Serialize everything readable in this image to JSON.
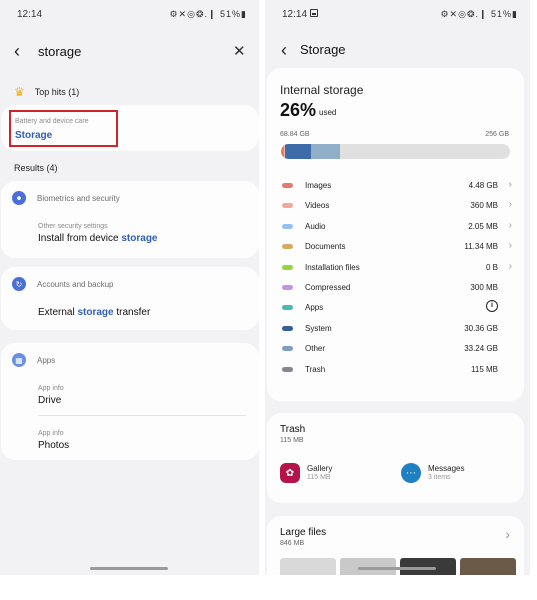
{
  "left": {
    "status": {
      "time": "12:14",
      "icons": "⚙✕◎❂.❙ 51%▮"
    },
    "search": {
      "query": "storage"
    },
    "top_hits": {
      "label": "Top hits (1)",
      "category": "Battery and device care",
      "title": "Storage"
    },
    "results": {
      "label": "Results (4)"
    },
    "sections": [
      {
        "name": "Biometrics and security",
        "sub": "Other security settings",
        "title_before": "Install from device ",
        "title_hl": "storage",
        "title_after": ""
      },
      {
        "name": "Accounts and backup",
        "title_before": "External ",
        "title_hl": "storage",
        "title_after": " transfer"
      },
      {
        "name": "Apps",
        "items": [
          {
            "sub": "App info",
            "title": "Drive"
          },
          {
            "sub": "App info",
            "title": "Photos"
          }
        ]
      }
    ]
  },
  "right": {
    "status": {
      "time": "12:14",
      "icons": "⚙✕◎❂.❙ 51%▮"
    },
    "page_title": "Storage",
    "internal": {
      "heading": "Internal storage",
      "percent": "26%",
      "used_label": "used",
      "used_amount": "68.84 GB",
      "capacity": "256 GB",
      "bar_fractions": [
        0.012,
        0.006,
        0.001,
        0.11,
        0.13
      ],
      "bar_colors": [
        "#e27a6b",
        "#f4b8ad",
        "#a9d4f3",
        "#3d6ca8",
        "#91aec8"
      ],
      "categories": [
        {
          "name": "Images",
          "size": "4.48 GB",
          "color": "#e8786a",
          "chevron": "›"
        },
        {
          "name": "Videos",
          "size": "360 MB",
          "color": "#f0a79e",
          "chevron": "›"
        },
        {
          "name": "Audio",
          "size": "2.05 MB",
          "color": "#93c1f0",
          "chevron": "›"
        },
        {
          "name": "Documents",
          "size": "11.34 MB",
          "color": "#d2aa63",
          "chevron": "›"
        },
        {
          "name": "Installation files",
          "size": "0 B",
          "color": "#97d33e",
          "chevron": "›"
        },
        {
          "name": "Compressed",
          "size": "300 MB",
          "color": "#c495dc",
          "chevron": ""
        },
        {
          "name": "Apps",
          "size": "",
          "color": "#49b8b0",
          "chevron": "",
          "info": "i"
        },
        {
          "name": "System",
          "size": "30.36 GB",
          "color": "#365f98",
          "chevron": ""
        },
        {
          "name": "Other",
          "size": "33.24 GB",
          "color": "#7e9fc0",
          "chevron": ""
        },
        {
          "name": "Trash",
          "size": "115 MB",
          "color": "#86868e",
          "chevron": ""
        }
      ]
    },
    "trash": {
      "title": "Trash",
      "size": "115 MB",
      "gallery": {
        "name": "Gallery",
        "size": "115 MB",
        "color": "#b5134a"
      },
      "messages": {
        "name": "Messages",
        "count": "3 items",
        "color": "#1f7fc0"
      }
    },
    "large_files": {
      "title": "Large files",
      "size": "846 MB",
      "chevron": "›"
    }
  }
}
